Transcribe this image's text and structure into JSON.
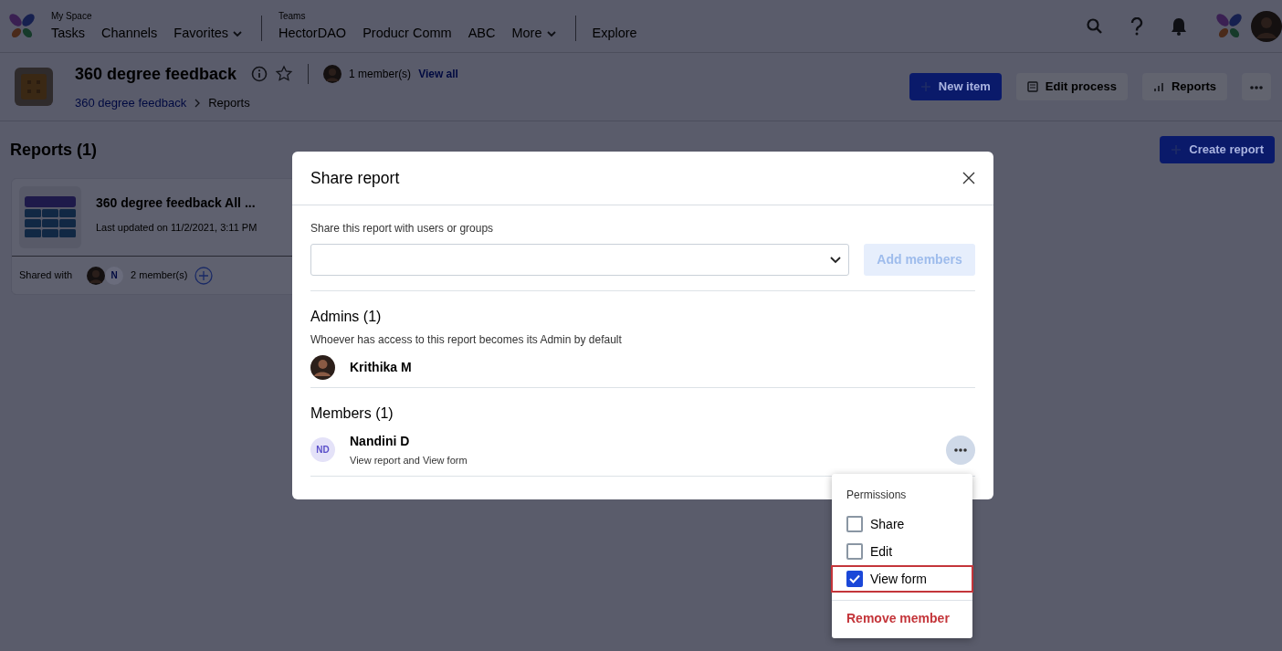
{
  "nav": {
    "groups": [
      {
        "caption": "My Space",
        "items": [
          {
            "label": "Tasks",
            "dropdown": false
          },
          {
            "label": "Channels",
            "dropdown": false
          },
          {
            "label": "Favorites",
            "dropdown": true
          }
        ]
      },
      {
        "caption": "Teams",
        "items": [
          {
            "label": "HectorDAO",
            "dropdown": false
          },
          {
            "label": "Producr Comm",
            "dropdown": false
          },
          {
            "label": "ABC",
            "dropdown": false
          },
          {
            "label": "More",
            "dropdown": true
          }
        ]
      },
      {
        "items": [
          {
            "label": "Explore",
            "dropdown": false
          }
        ]
      }
    ]
  },
  "header": {
    "title": "360 degree feedback",
    "members": "1 member(s)",
    "view_all": "View all",
    "breadcrumb": [
      "360 degree feedback",
      "Reports"
    ],
    "buttons": [
      {
        "label": "New item",
        "kind": "primary"
      },
      {
        "label": "Edit process",
        "kind": "edit"
      },
      {
        "label": "Reports",
        "kind": "chart"
      }
    ]
  },
  "reports": {
    "title": "Reports (1)",
    "create_button": "Create report",
    "cards": [
      {
        "title": "360 degree feedback All ...",
        "updated": "Last updated on 11/2/2021, 3:11 PM",
        "shared_label": "Shared with",
        "avatar_initial": "N",
        "members": "2 member(s)"
      }
    ]
  },
  "dialog": {
    "title": "Share report",
    "field_label": "Share this report with users or groups",
    "add_button": {
      "label": "Add members",
      "disabled": true
    },
    "admins": {
      "title": "Admins (1)",
      "note": "Whoever has access to this report becomes its Admin by default",
      "people": [
        {
          "name": "Krithika M"
        }
      ]
    },
    "members": {
      "title": "Members (1)",
      "people": [
        {
          "initials": "ND",
          "name": "Nandini D",
          "permissions": "View report and View form"
        }
      ]
    }
  },
  "menu": {
    "heading": "Permissions",
    "options": [
      {
        "label": "Share",
        "checked": false,
        "highlighted": false
      },
      {
        "label": "Edit",
        "checked": false,
        "highlighted": false
      },
      {
        "label": "View form",
        "checked": true,
        "highlighted": true
      }
    ],
    "remove": "Remove member"
  }
}
